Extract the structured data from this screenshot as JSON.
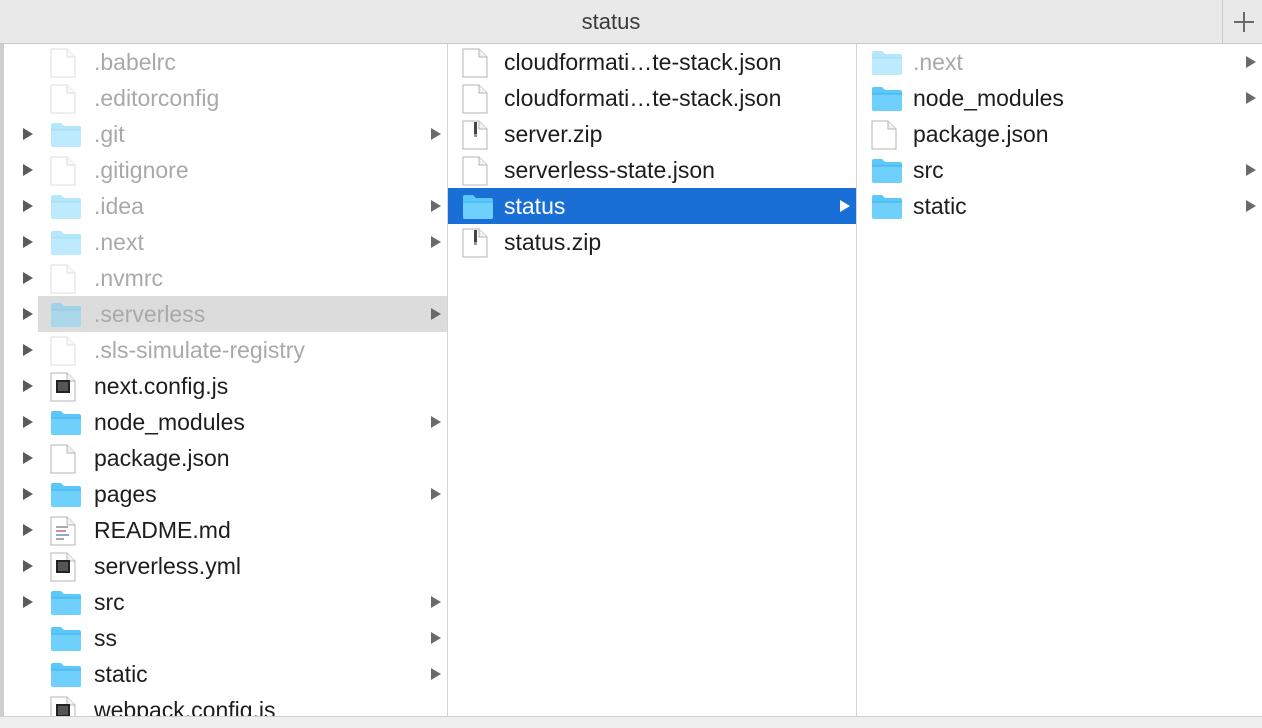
{
  "window": {
    "title": "status"
  },
  "columns": [
    {
      "items": [
        {
          "label": ".babelrc",
          "icon": "file-icon",
          "dim": true,
          "arrow": false
        },
        {
          "label": ".editorconfig",
          "icon": "file-icon",
          "dim": true,
          "arrow": false
        },
        {
          "label": ".git",
          "icon": "folder-icon",
          "dim": true,
          "arrow": true
        },
        {
          "label": ".gitignore",
          "icon": "file-icon",
          "dim": true,
          "arrow": false
        },
        {
          "label": ".idea",
          "icon": "folder-icon",
          "dim": true,
          "arrow": true
        },
        {
          "label": ".next",
          "icon": "folder-icon",
          "dim": true,
          "arrow": true
        },
        {
          "label": ".nvmrc",
          "icon": "file-icon",
          "dim": true,
          "arrow": false
        },
        {
          "label": ".serverless",
          "icon": "folder-icon",
          "dim": true,
          "arrow": true,
          "state": "hover"
        },
        {
          "label": ".sls-simulate-registry",
          "icon": "file-icon",
          "dim": true,
          "arrow": false
        },
        {
          "label": "next.config.js",
          "icon": "js-file-icon",
          "dim": false,
          "arrow": false
        },
        {
          "label": "node_modules",
          "icon": "folder-icon",
          "dim": false,
          "arrow": true
        },
        {
          "label": "package.json",
          "icon": "file-icon",
          "dim": false,
          "arrow": false
        },
        {
          "label": "pages",
          "icon": "folder-icon",
          "dim": false,
          "arrow": true
        },
        {
          "label": "README.md",
          "icon": "markdown-file-icon",
          "dim": false,
          "arrow": false
        },
        {
          "label": "serverless.yml",
          "icon": "yaml-file-icon",
          "dim": false,
          "arrow": false
        },
        {
          "label": "src",
          "icon": "folder-icon",
          "dim": false,
          "arrow": true
        },
        {
          "label": "ss",
          "icon": "folder-icon",
          "dim": false,
          "arrow": true
        },
        {
          "label": "static",
          "icon": "folder-icon",
          "dim": false,
          "arrow": true
        },
        {
          "label": "webpack.config.js",
          "icon": "js-file-icon",
          "dim": false,
          "arrow": false
        }
      ]
    },
    {
      "items": [
        {
          "label": "cloudformati…te-stack.json",
          "icon": "file-icon",
          "dim": false,
          "arrow": false
        },
        {
          "label": "cloudformati…te-stack.json",
          "icon": "file-icon",
          "dim": false,
          "arrow": false
        },
        {
          "label": "server.zip",
          "icon": "zip-file-icon",
          "dim": false,
          "arrow": false
        },
        {
          "label": "serverless-state.json",
          "icon": "file-icon",
          "dim": false,
          "arrow": false
        },
        {
          "label": "status",
          "icon": "folder-icon",
          "dim": false,
          "arrow": true,
          "state": "selected"
        },
        {
          "label": "status.zip",
          "icon": "zip-file-icon",
          "dim": false,
          "arrow": false
        }
      ]
    },
    {
      "items": [
        {
          "label": ".next",
          "icon": "folder-icon",
          "dim": true,
          "arrow": true
        },
        {
          "label": "node_modules",
          "icon": "folder-icon",
          "dim": false,
          "arrow": true
        },
        {
          "label": "package.json",
          "icon": "file-icon",
          "dim": false,
          "arrow": false
        },
        {
          "label": "src",
          "icon": "folder-icon",
          "dim": false,
          "arrow": true
        },
        {
          "label": "static",
          "icon": "folder-icon",
          "dim": false,
          "arrow": true
        }
      ]
    }
  ],
  "gutter_expanders": [
    2,
    3,
    4,
    5,
    6,
    7,
    8,
    9,
    10,
    11,
    12,
    13,
    14,
    15
  ],
  "colors": {
    "selection": "#1a6fd7",
    "folder": "#5ac8fa",
    "hover_row": "#dcdcdc"
  }
}
